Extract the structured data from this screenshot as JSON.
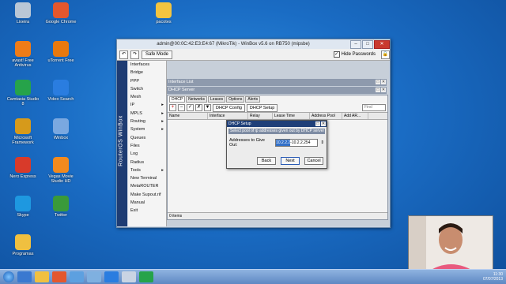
{
  "desktop": {
    "icons": [
      {
        "label": "Lixeira",
        "color": "#b9c7d6"
      },
      {
        "label": "Google Chrome",
        "color": "#e4572e"
      },
      {
        "label": "pacotes",
        "color": "#f3c440"
      },
      {
        "label": "avast! Free Antivirus",
        "color": "#f07c17"
      },
      {
        "label": "uTorrent Free",
        "color": "#e8790e"
      },
      {
        "label": "Camtasia Studio 8",
        "color": "#26a34a"
      },
      {
        "label": "Video Search",
        "color": "#2a7de0"
      },
      {
        "label": "Microsoft Framework",
        "color": "#d69a1b"
      },
      {
        "label": "Winbox",
        "color": "#7aa8e0"
      },
      {
        "label": "Nero Express",
        "color": "#d83a2a"
      },
      {
        "label": "Vegas Movie Studio HD",
        "color": "#f28a1e"
      },
      {
        "label": "Skype",
        "color": "#1e98e0"
      },
      {
        "label": "Twitter",
        "color": "#3a9a3a"
      },
      {
        "label": "Programas",
        "color": "#f0c040"
      }
    ]
  },
  "winbox": {
    "title": "admin@00:0C:42:E3:E4:67 (MikroTik) - WinBox v5.6 on RB750 (mipsbe)",
    "safe_mode": "Safe Mode",
    "hide_passwords": "Hide Passwords",
    "side_brand": "RouterOS WinBox",
    "menu": [
      {
        "label": "Interfaces",
        "arrow": ""
      },
      {
        "label": "Bridge",
        "arrow": ""
      },
      {
        "label": "PPP",
        "arrow": ""
      },
      {
        "label": "Switch",
        "arrow": ""
      },
      {
        "label": "Mesh",
        "arrow": ""
      },
      {
        "label": "IP",
        "arrow": "▸"
      },
      {
        "label": "MPLS",
        "arrow": "▸"
      },
      {
        "label": "Routing",
        "arrow": "▸"
      },
      {
        "label": "System",
        "arrow": "▸"
      },
      {
        "label": "Queues",
        "arrow": ""
      },
      {
        "label": "Files",
        "arrow": ""
      },
      {
        "label": "Log",
        "arrow": ""
      },
      {
        "label": "Radius",
        "arrow": ""
      },
      {
        "label": "Tools",
        "arrow": "▸"
      },
      {
        "label": "New Terminal",
        "arrow": ""
      },
      {
        "label": "MetaROUTER",
        "arrow": ""
      },
      {
        "label": "Make Supout.rif",
        "arrow": ""
      },
      {
        "label": "Manual",
        "arrow": ""
      },
      {
        "label": "Exit",
        "arrow": ""
      }
    ]
  },
  "interface_list": {
    "title": "Interface List"
  },
  "dhcp_server": {
    "title": "DHCP Server",
    "tabs": [
      "DHCP",
      "Networks",
      "Leases",
      "Options",
      "Alerts"
    ],
    "btn_config": "DHCP Config",
    "btn_setup": "DHCP Setup",
    "find_placeholder": "Find",
    "columns": [
      "Name",
      "Interface",
      "Relay",
      "Lease Time",
      "Address Pool",
      "Add AR..."
    ],
    "status": "0 items"
  },
  "dhcp_setup": {
    "title": "DHCP Setup",
    "message": "Select pool of ip addresses given out by DHCP server",
    "field_label": "Addresses to Give Out:",
    "range_selected": "10.2.2.2",
    "range_rest": "-10.2.2.254",
    "btn_back": "Back",
    "btn_next": "Next",
    "btn_cancel": "Cancel"
  },
  "taskbar": {
    "time": "11:30",
    "date": "07/07/2013",
    "apps": [
      {
        "color": "#3a79d0"
      },
      {
        "color": "#f0c040"
      },
      {
        "color": "#e4572e"
      },
      {
        "color": "#5da0e0"
      },
      {
        "color": "#7fb0e0"
      },
      {
        "color": "#2a7de0"
      },
      {
        "color": "#c9d4e3"
      },
      {
        "color": "#26a34a"
      }
    ]
  }
}
